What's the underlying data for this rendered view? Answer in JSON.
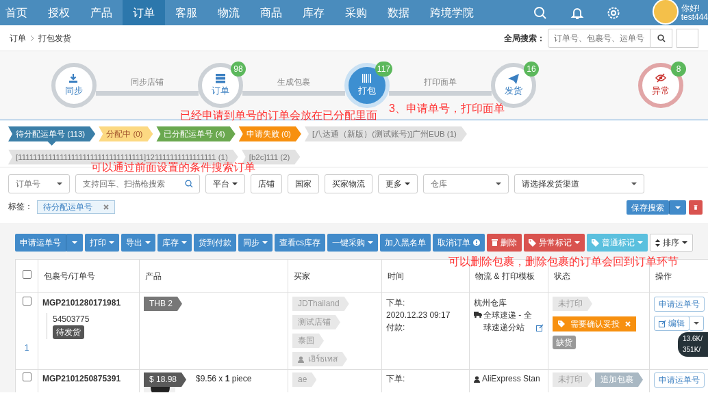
{
  "nav": {
    "items": [
      {
        "label": "首页",
        "selected": false
      },
      {
        "label": "授权",
        "selected": false
      },
      {
        "label": "产品",
        "selected": false
      },
      {
        "label": "订单",
        "selected": true
      },
      {
        "label": "客服",
        "selected": false
      },
      {
        "label": "物流",
        "selected": false
      },
      {
        "label": "商品",
        "selected": false
      },
      {
        "label": "库存",
        "selected": false
      },
      {
        "label": "采购",
        "selected": false
      },
      {
        "label": "数据",
        "selected": false
      },
      {
        "label": "跨境学院",
        "selected": false
      }
    ],
    "greeting": "你好!",
    "user": "test444"
  },
  "breadcrumb": [
    "订单",
    "打包发货"
  ],
  "global_search": {
    "label": "全局搜索：",
    "placeholder": "订单号、包裹号、运单号"
  },
  "steps": [
    {
      "label": "同步",
      "kind": "normal",
      "selected": false,
      "link_label": "同步店铺"
    },
    {
      "label": "订单",
      "kind": "normal",
      "selected": false,
      "count": "98",
      "link_label": "生成包裹"
    },
    {
      "label": "打包",
      "kind": "normal",
      "selected": true,
      "count": "117",
      "link_label": "打印面单"
    },
    {
      "label": "发货",
      "kind": "normal",
      "selected": false,
      "count": "16"
    },
    {
      "label": "异常",
      "kind": "error",
      "selected": false,
      "count": "8"
    }
  ],
  "annotations": [
    "3、申请单号，打印面单",
    "已经申请到单号的订单会放在已分配里面",
    "可以通过前面设置的条件搜索订单",
    "可以删除包裹，删除包裹的订单会回到订单环节"
  ],
  "status_tabs": [
    {
      "label": "待分配运单号 (113)",
      "selected": true,
      "color": "#3b7fa8"
    },
    {
      "label": "分配中 (0)",
      "selected": false,
      "color": "#fcd982"
    },
    {
      "label": "已分配运单号 (4)",
      "selected": false,
      "color": "#6aa84f"
    },
    {
      "label": "申请失败 (0)",
      "selected": false,
      "color": "#f7900f"
    },
    {
      "label": "[八达通（新版）(测试账号)]广州EUB (1)",
      "selected": false,
      "color": "#e2e2e2"
    },
    {
      "label": "[111111111111111111111111111111111]121111111111111111 (1)",
      "selected": false,
      "color": "#e2e2e2"
    },
    {
      "label": "[b2c]111 (2)",
      "selected": false,
      "color": "#e2e2e2"
    }
  ],
  "filters": [
    {
      "kind": "select",
      "label": "订单号"
    },
    {
      "kind": "search",
      "placeholder": "支持回车、扫描枪搜索"
    },
    {
      "kind": "dropdown",
      "label": "平台"
    },
    {
      "kind": "button",
      "label": "店铺"
    },
    {
      "kind": "button",
      "label": "国家"
    },
    {
      "kind": "button",
      "label": "买家物流"
    },
    {
      "kind": "dropdown",
      "label": "更多"
    },
    {
      "kind": "select",
      "label": "仓库",
      "muted": true
    },
    {
      "kind": "select",
      "label": "请选择发货渠道",
      "muted": false
    }
  ],
  "tag_filter": {
    "label": "标签：",
    "chips": [
      "待分配运单号"
    ]
  },
  "save_search": "保存搜索",
  "toolbar": [
    {
      "label": "申请运单号",
      "kind": "split"
    },
    {
      "label": "打印",
      "kind": "dropdown"
    },
    {
      "label": "导出",
      "kind": "dropdown"
    },
    {
      "label": "库存",
      "kind": "dropdown"
    },
    {
      "label": "货到付款",
      "kind": "button"
    },
    {
      "label": "同步",
      "kind": "dropdown"
    },
    {
      "label": "查看cs库存",
      "kind": "button"
    },
    {
      "label": "一键采购",
      "kind": "dropdown"
    },
    {
      "label": "加入黑名单",
      "kind": "button"
    },
    {
      "label": "取消订单",
      "kind": "info"
    },
    {
      "label": "删除",
      "kind": "delete"
    },
    {
      "label": "异常标记",
      "kind": "flag"
    },
    {
      "label": "普通标记",
      "kind": "tag"
    },
    {
      "label": "排序",
      "kind": "sort"
    }
  ],
  "table": {
    "select_all_checked": false,
    "columns": [
      "包裹号/订单号",
      "产品",
      "买家",
      "时间",
      "物流 & 打印模板",
      "状态",
      "操作"
    ],
    "rows": [
      {
        "checked": false,
        "package": "MGP2101280171981",
        "order": "54503775",
        "order_status": "待发货",
        "index": "1",
        "product_tag": "THB 2",
        "buyer": [
          "JDThailand",
          "测试店铺",
          "泰国"
        ],
        "buyer_user": "เอิร์ธเทส",
        "time": [
          "下单:",
          "2020.12.23 09:17",
          "付款:"
        ],
        "warehouse": "杭州仓库",
        "shipping": "全球速递 - 全球速递分站",
        "status": [
          "未打印"
        ],
        "flag": "需要确认妥投",
        "stock": "缺货",
        "actions": [
          "申请运单号",
          "编辑"
        ]
      },
      {
        "checked": false,
        "package": "MGP2101250875391",
        "price": "$ 18.98",
        "product_line": "$9.56 x **1** piece",
        "buyer": [
          "ae"
        ],
        "time": [
          "下单:"
        ],
        "shipping_user": "AliExpress Stan",
        "status": [
          "未打印",
          "追加包裹"
        ],
        "actions": [
          "申请运单号"
        ]
      }
    ]
  },
  "speed": {
    "up": "13.6K/",
    "down": "351K/"
  }
}
